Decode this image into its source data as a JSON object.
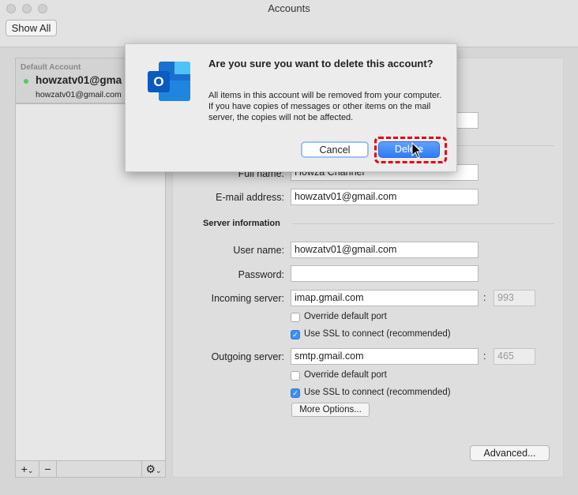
{
  "window": {
    "title": "Accounts"
  },
  "toolbar": {
    "show_all": "Show All"
  },
  "sidebar": {
    "header": "Default Account",
    "account_name": "howzatv01@gma",
    "account_email": "howzatv01@gmail.com",
    "status_color": "#5ac85a",
    "add": "+",
    "remove": "−",
    "gear": "⚙"
  },
  "form": {
    "full_name_label": "Full name:",
    "full_name": "Howza Channel",
    "email_label": "E-mail address:",
    "email": "howzatv01@gmail.com",
    "server_section": "Server information",
    "user_label": "User name:",
    "user": "howzatv01@gmail.com",
    "password_label": "Password:",
    "password": "",
    "incoming_label": "Incoming server:",
    "incoming": "imap.gmail.com",
    "incoming_port": "993",
    "outgoing_label": "Outgoing server:",
    "outgoing": "smtp.gmail.com",
    "outgoing_port": "465",
    "override_label": "Override default port",
    "ssl_label": "Use SSL to connect (recommended)",
    "incoming_override": false,
    "incoming_ssl": true,
    "outgoing_override": false,
    "outgoing_ssl": true,
    "more_options": "More Options...",
    "advanced": "Advanced..."
  },
  "dialog": {
    "title": "Are you sure you want to delete this account?",
    "message": "All items in this account will be removed from your computer. If you have copies of messages or other items on the mail server, the copies will not be affected.",
    "cancel": "Cancel",
    "delete": "Delete",
    "highlight_color": "#e8000b",
    "accent": "#2f7cf6"
  }
}
